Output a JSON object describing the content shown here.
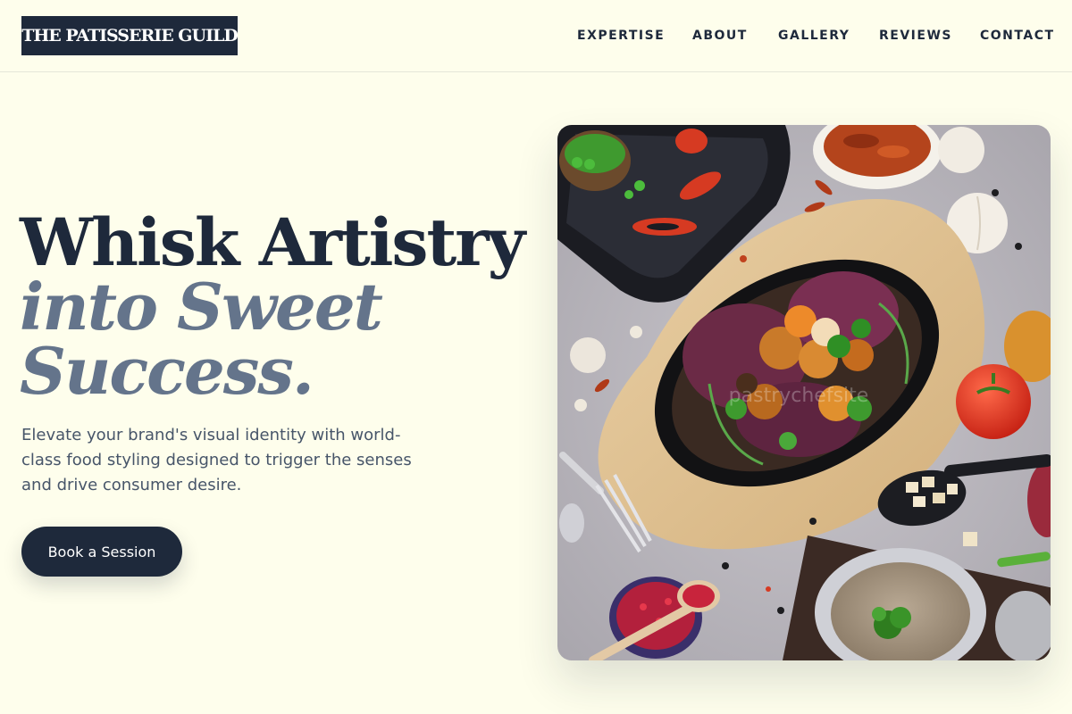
{
  "brand": {
    "name": "THE PATISSERIE GUILD"
  },
  "nav": {
    "items": [
      {
        "label": "EXPERTISE"
      },
      {
        "label": "ABOUT"
      },
      {
        "label": "GALLERY"
      },
      {
        "label": "REVIEWS"
      },
      {
        "label": "CONTACT"
      }
    ]
  },
  "hero": {
    "line1": "Whisk Artistry",
    "line2": "into Sweet",
    "line3": "Success.",
    "description": "Elevate your brand's visual identity with world-class food styling designed to trigger the senses and drive consumer desire.",
    "cta_label": "Book a Session",
    "image_alt": "Overhead photo of a food spread: sizzling plate with roasted vegetables and greens, bowl of soup, spices, garlic, tomato and onion",
    "watermark": "pastrychefsite"
  },
  "colors": {
    "background": "#fefeec",
    "primary": "#1e293b",
    "muted_heading": "#64748b",
    "body_text": "#475569"
  }
}
